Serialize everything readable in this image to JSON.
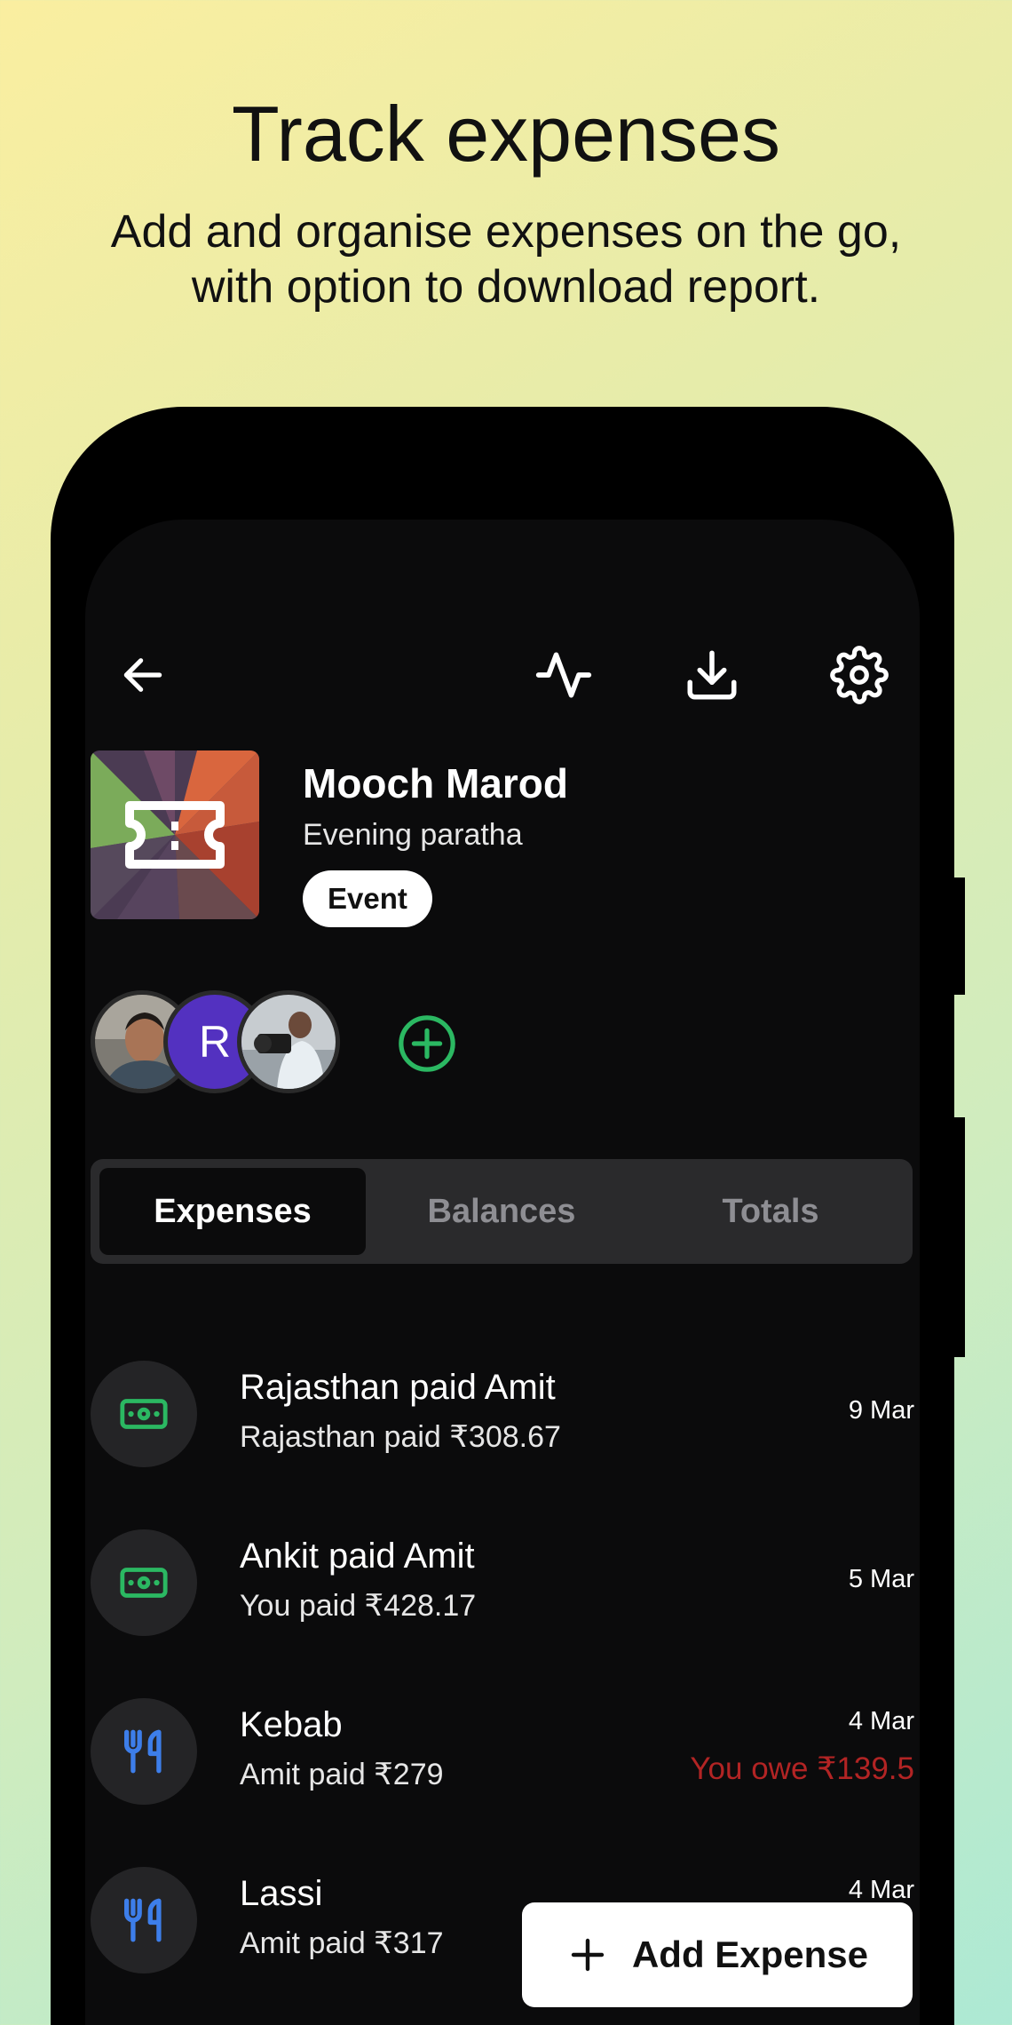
{
  "promo": {
    "title": "Track expenses",
    "subtitle": "Add and organise expenses on the go, with option to download report."
  },
  "toolbar": {
    "back_icon": "arrow-left-icon",
    "activity_icon": "activity-icon",
    "download_icon": "download-icon",
    "settings_icon": "gear-icon"
  },
  "group": {
    "name": "Mooch Marod",
    "description": "Evening paratha",
    "badge": "Event"
  },
  "members": [
    {
      "type": "photo"
    },
    {
      "type": "letter",
      "letter": "R",
      "color": "#5331c0"
    },
    {
      "type": "photo"
    }
  ],
  "tabs": [
    {
      "label": "Expenses",
      "active": true
    },
    {
      "label": "Balances",
      "active": false
    },
    {
      "label": "Totals",
      "active": false
    }
  ],
  "expenses": [
    {
      "icon": "cash-icon",
      "title": "Rajasthan paid Amit",
      "subtitle": "Rajasthan paid ₹308.67",
      "date": "9 Mar",
      "owe": ""
    },
    {
      "icon": "cash-icon",
      "title": "Ankit paid Amit",
      "subtitle": "You paid ₹428.17",
      "date": "5 Mar",
      "owe": ""
    },
    {
      "icon": "fork-knife-icon",
      "title": "Kebab",
      "subtitle": "Amit paid ₹279",
      "date": "4 Mar",
      "owe": "You owe ₹139.5"
    },
    {
      "icon": "fork-knife-icon",
      "title": "Lassi",
      "subtitle": "Amit paid ₹317",
      "date": "4 Mar",
      "owe": ""
    }
  ],
  "fab": {
    "label": "Add Expense"
  },
  "colors": {
    "accent_green": "#2bb862",
    "accent_blue": "#3d7eea",
    "owe_red": "#b22424",
    "avatar_purple": "#5331c0"
  }
}
